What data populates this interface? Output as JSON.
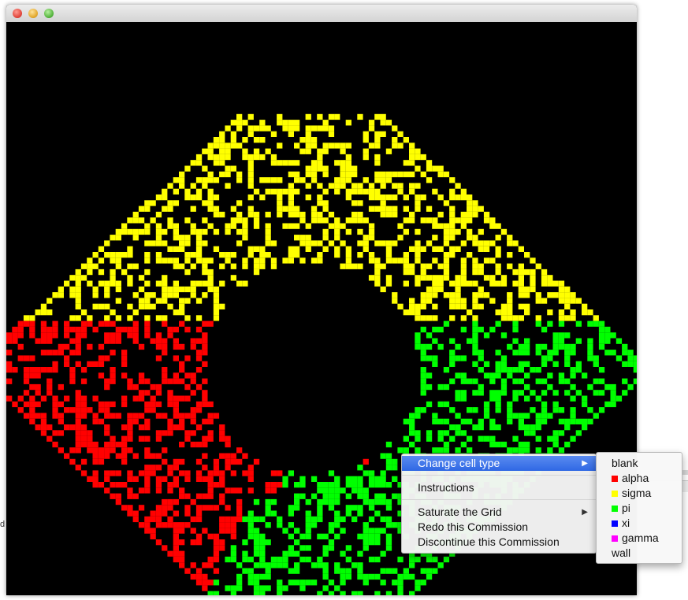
{
  "window": {
    "controls": [
      "close",
      "minimize",
      "zoom"
    ]
  },
  "grid": {
    "background": "#000000",
    "cell_colors": {
      "alpha": "#ff0000",
      "sigma": "#ffff00",
      "pi": "#00ff00"
    }
  },
  "context_menu": {
    "items": [
      {
        "label": "Change cell type",
        "has_submenu": true,
        "highlighted": true
      },
      {
        "label": "Instructions"
      },
      {
        "label": "Saturate the Grid",
        "has_submenu": true
      },
      {
        "label": "Redo this Commission"
      },
      {
        "label": "Discontinue this Commission"
      }
    ],
    "submenu_arrow": "▶"
  },
  "cell_type_submenu": {
    "items": [
      {
        "label": "blank"
      },
      {
        "label": "alpha",
        "color": "#ff0000"
      },
      {
        "label": "sigma",
        "color": "#ffff00"
      },
      {
        "label": "pi",
        "color": "#00ff00"
      },
      {
        "label": "xi",
        "color": "#0000ff"
      },
      {
        "label": "gamma",
        "color": "#ff00ff"
      },
      {
        "label": "wall"
      }
    ]
  },
  "background_fragment": "d"
}
